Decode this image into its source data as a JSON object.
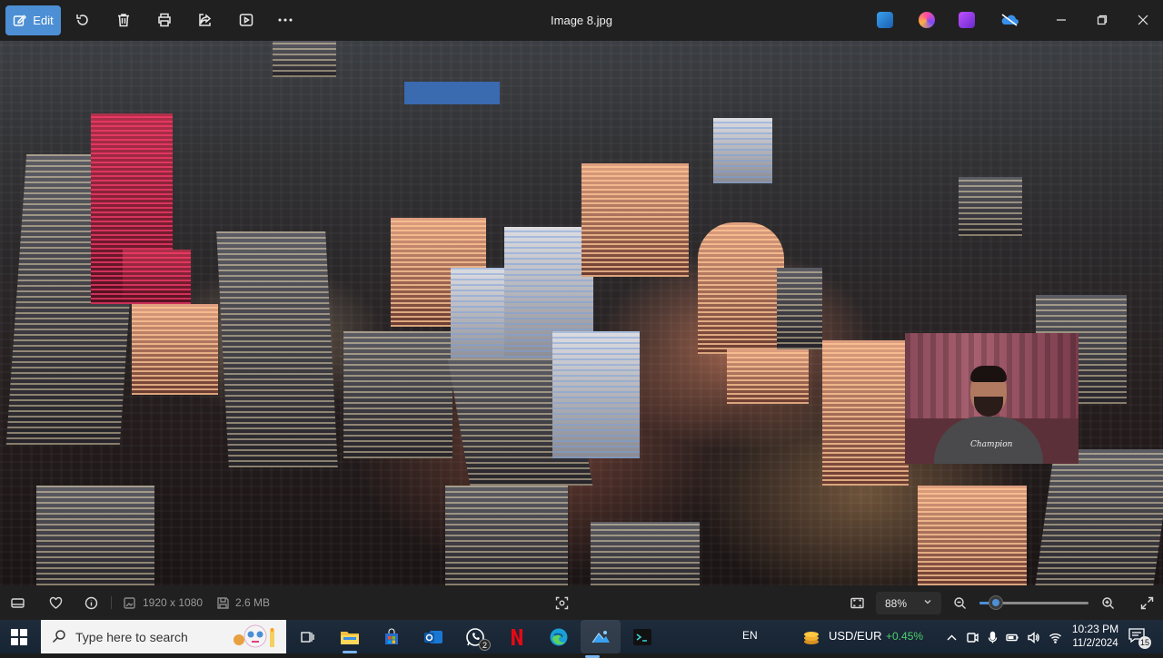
{
  "toolbar": {
    "edit_label": "Edit",
    "file_title": "Image 8.jpg",
    "tools": [
      "rotate-icon",
      "delete-icon",
      "print-icon",
      "share-icon",
      "slideshow-icon",
      "more-icon"
    ],
    "app_icons": [
      "designer-icon",
      "clipchamp-icon",
      "copilot-icon",
      "onedrive-icon"
    ]
  },
  "webcam": {
    "shirt_text": "Champion"
  },
  "statusbar": {
    "dimensions": "1920 x 1080",
    "file_size": "2.6 MB",
    "zoom_value": "88%",
    "zoom_fraction": 0.15
  },
  "taskbar": {
    "search_placeholder": "Type here to search",
    "whatsapp_badge": "2",
    "language": "EN",
    "currency_pair": "USD/EUR",
    "currency_change": "+0.45%",
    "time": "10:23 PM",
    "date": "11/2/2024",
    "notification_count": "15"
  },
  "colors": {
    "accent": "#4d8fd4",
    "toolbar_bg": "#202020",
    "taskbar_bg": "#1e2b3b",
    "positive": "#4ccf6e"
  }
}
